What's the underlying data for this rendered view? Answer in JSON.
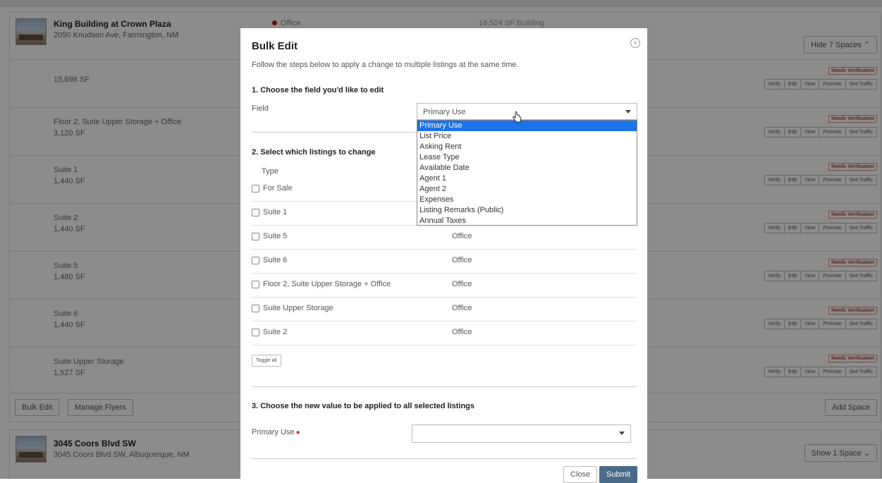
{
  "property1": {
    "title": "King Building at Crown Plaza",
    "address": "2050 Knudsen Ave, Farmington, NM",
    "type": "Office",
    "size": "16,524 SF Building",
    "toggle": "Hide 7 Spaces ⌃"
  },
  "spaces": [
    {
      "name": "",
      "size": "15,698 SF",
      "badge": "Needs Verification"
    },
    {
      "name": "Floor 2, Suite Upper Storage + Office",
      "size": "3,120 SF",
      "badge": "Needs Verification"
    },
    {
      "name": "Suite 1",
      "size": "1,440 SF",
      "badge": "Needs Verification"
    },
    {
      "name": "Suite 2",
      "size": "1,440 SF",
      "badge": "Needs Verification"
    },
    {
      "name": "Suite 5",
      "size": "1,480 SF",
      "badge": "Needs Verification"
    },
    {
      "name": "Suite 6",
      "size": "1,440 SF",
      "badge": "Needs Verification"
    },
    {
      "name": "Suite Upper Storage",
      "size": "1,527 SF",
      "badge": "Needs Verification"
    }
  ],
  "row_actions": [
    "Verify",
    "Edit",
    "View",
    "Promote",
    "See Traffic"
  ],
  "footer": {
    "bulk_edit": "Bulk Edit",
    "manage_flyers": "Manage Flyers",
    "add_space": "Add Space"
  },
  "property2": {
    "title": "3045 Coors Blvd SW",
    "address": "3045 Coors Blvd SW, Albuquerque, NM",
    "toggle": "Show 1 Space ⌄"
  },
  "modal": {
    "title": "Bulk Edit",
    "close_glyph": "x",
    "intro": "Follow the steps below to apply a change to multiple listings at the same time.",
    "step1": "1. Choose the field you'd like to edit",
    "field_label": "Field",
    "field_value": "Primary Use",
    "options": [
      "Primary Use",
      "List Price",
      "Asking Rent",
      "Lease Type",
      "Available Date",
      "Agent 1",
      "Agent 2",
      "Expenses",
      "Listing Remarks (Public)",
      "Annual Taxes"
    ],
    "step2": "2. Select which listings to change",
    "type_header": "Type",
    "listings": [
      {
        "label": "For Sale",
        "use": ""
      },
      {
        "label": "Suite 1",
        "use": ""
      },
      {
        "label": "Suite 5",
        "use": "Office"
      },
      {
        "label": "Suite 6",
        "use": "Office"
      },
      {
        "label": "Floor 2, Suite Upper Storage + Office",
        "use": "Office"
      },
      {
        "label": "Suite Upper Storage",
        "use": "Office"
      },
      {
        "label": "Suite 2",
        "use": "Office"
      }
    ],
    "toggle_all": "Toggle all",
    "step3": "3. Choose the new value to be applied to all selected listings",
    "new_value_label": "Primary Use",
    "required_mark": "●",
    "new_value": "",
    "close_btn": "Close",
    "submit_btn": "Submit"
  },
  "colors": {
    "submit": "#4a6b8a",
    "badge": "#c0392b",
    "selected_option": "#1e73e8"
  }
}
